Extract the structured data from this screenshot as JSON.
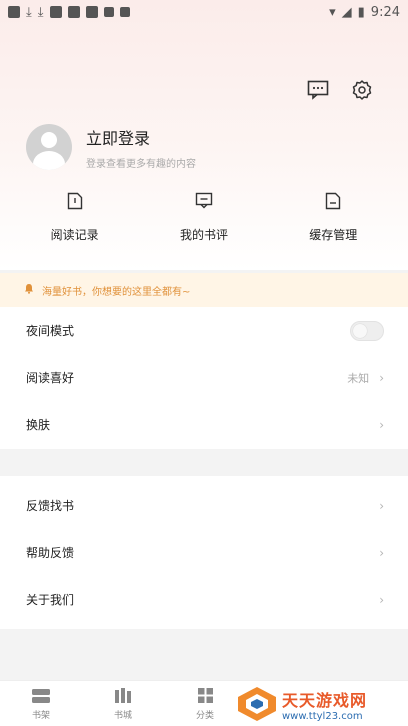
{
  "status_bar": {
    "time": "9:24"
  },
  "header": {
    "message_icon": "message-icon",
    "settings_icon": "gear-icon",
    "login_title": "立即登录",
    "login_subtitle": "登录查看更多有趣的内容",
    "quick_actions": [
      {
        "icon": "document-icon",
        "label": "阅读记录"
      },
      {
        "icon": "comment-icon",
        "label": "我的书评"
      },
      {
        "icon": "file-icon",
        "label": "缓存管理"
      }
    ]
  },
  "notice": {
    "text": "海量好书，你想要的这里全都有~"
  },
  "settings": {
    "group1": [
      {
        "label": "夜间模式",
        "toggle": false
      },
      {
        "label": "阅读喜好",
        "value": "未知"
      },
      {
        "label": "换肤"
      }
    ],
    "group2": [
      {
        "label": "反馈找书"
      },
      {
        "label": "帮助反馈"
      },
      {
        "label": "关于我们"
      }
    ]
  },
  "bottom_nav": [
    {
      "icon": "bookshelf-icon",
      "label": "书架"
    },
    {
      "icon": "bookstore-icon",
      "label": "书城"
    },
    {
      "icon": "grid-icon",
      "label": "分类"
    }
  ],
  "watermark": {
    "title": "天天游戏网",
    "url": "www.ttyl23.com"
  },
  "colors": {
    "accent": "#e0913a",
    "notice_bg": "#fff5e6",
    "header_bg": "#fbecea"
  }
}
